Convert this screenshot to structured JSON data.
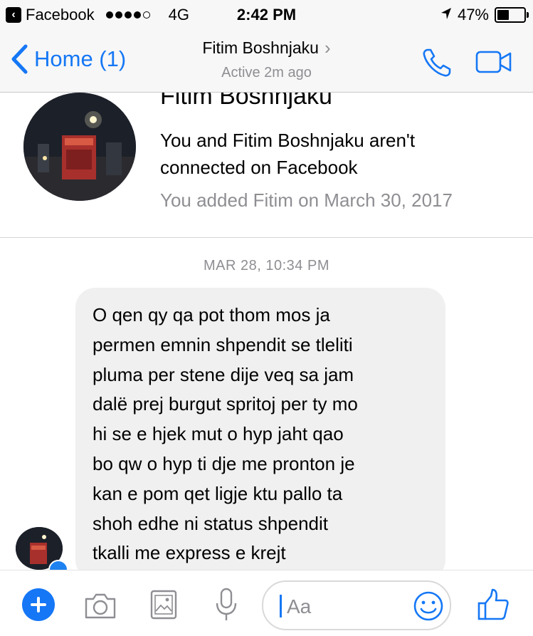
{
  "status_bar": {
    "back_app": "Facebook",
    "network": "4G",
    "time": "2:42 PM",
    "battery": "47%",
    "battery_level": 0.47
  },
  "nav": {
    "back_label": "Home (1)",
    "title": "Fitim Boshnjaku",
    "subtitle": "Active 2m ago",
    "accent_color": "#1577f5"
  },
  "profile": {
    "name": "Fitim Boshnjaku",
    "connection_info": "You and Fitim Boshnjaku aren't connected on Facebook",
    "added_info": "You added Fitim on March 30, 2017"
  },
  "chat": {
    "timestamp": "MAR 28, 10:34 PM",
    "message_lines": [
      "O qen qy qa pot thom mos ja",
      "permen emnin shpendit se tleliti",
      "pluma per stene dije veq sa jam",
      "dalë prej burgut spritoj per ty mo",
      "hi se e hjek mut o hyp jaht qao",
      "bo qw o hyp ti dje me pronton je",
      "kan e pom qet ligje ktu pallo ta",
      "shoh edhe ni status shpendit",
      "tkalli me express e krejt"
    ]
  },
  "composer": {
    "placeholder": "Aa",
    "icons": [
      "plus-icon",
      "camera-icon",
      "photo-icon",
      "microphone-icon",
      "emoji-icon",
      "thumbs-up-icon"
    ]
  }
}
